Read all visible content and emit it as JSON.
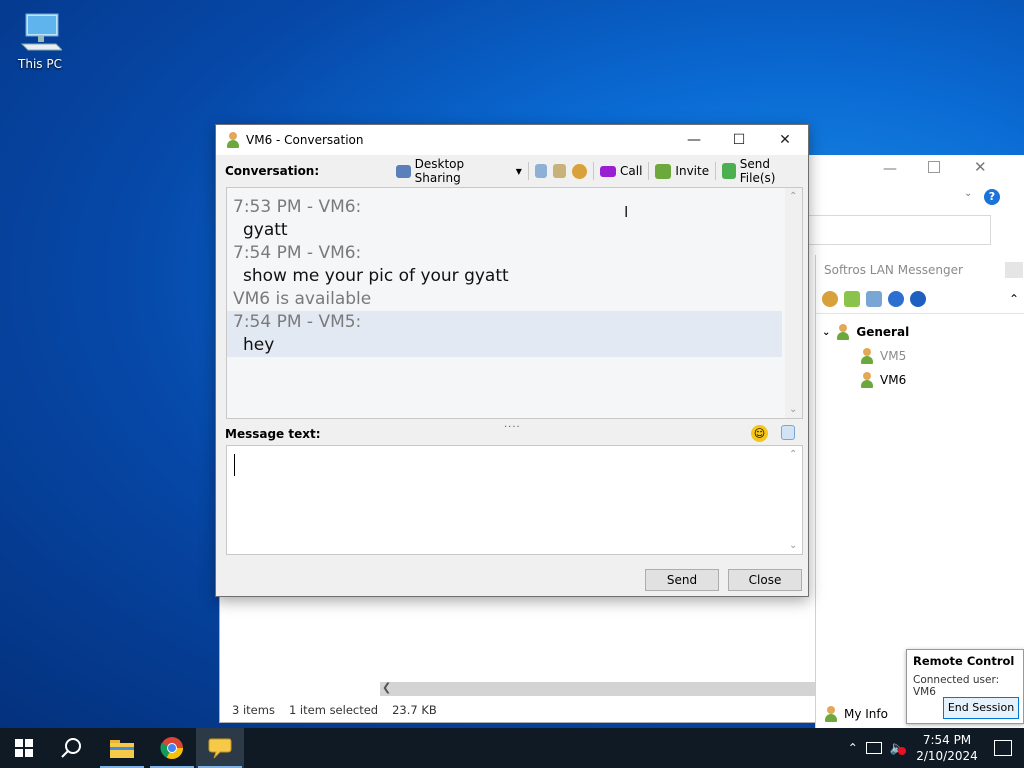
{
  "desktop": {
    "icon_label": "This PC"
  },
  "explorer": {
    "status": {
      "items": "3 items",
      "selected": "1 item selected",
      "size": "23.7 KB"
    }
  },
  "messenger": {
    "title": "Softros LAN Messenger",
    "tree": {
      "group": "General",
      "users": [
        {
          "name": "VM5",
          "status": "away"
        },
        {
          "name": "VM6",
          "status": "online"
        }
      ]
    },
    "my_info": "My Info"
  },
  "remote": {
    "title": "Remote Control",
    "connected": "Connected user: VM6",
    "end_button": "End Session"
  },
  "conversation": {
    "window_title": "VM6 - Conversation",
    "conversation_label": "Conversation:",
    "toolbar": {
      "desktop_sharing": "Desktop Sharing",
      "call": "Call",
      "invite": "Invite",
      "send_files": "Send File(s)"
    },
    "messages": [
      {
        "header": "7:53 PM - VM6:",
        "text": "gyatt"
      },
      {
        "header": "7:54 PM - VM6:",
        "text": "show me your pic of your gyatt"
      },
      {
        "system": "VM6 is available"
      },
      {
        "header": "7:54 PM - VM5:",
        "text": "hey"
      }
    ],
    "message_label": "Message text:",
    "input_value": "",
    "send_button": "Send",
    "close_button": "Close"
  },
  "taskbar": {
    "apps": [
      "start",
      "search",
      "file-explorer",
      "chrome",
      "softros-messenger"
    ],
    "clock_time": "7:54 PM",
    "clock_date": "2/10/2024"
  },
  "colors": {
    "desktop_bg": "#0a6bd4",
    "taskbar_bg": "#101a24",
    "highlight_row": "#e3e9f3"
  }
}
